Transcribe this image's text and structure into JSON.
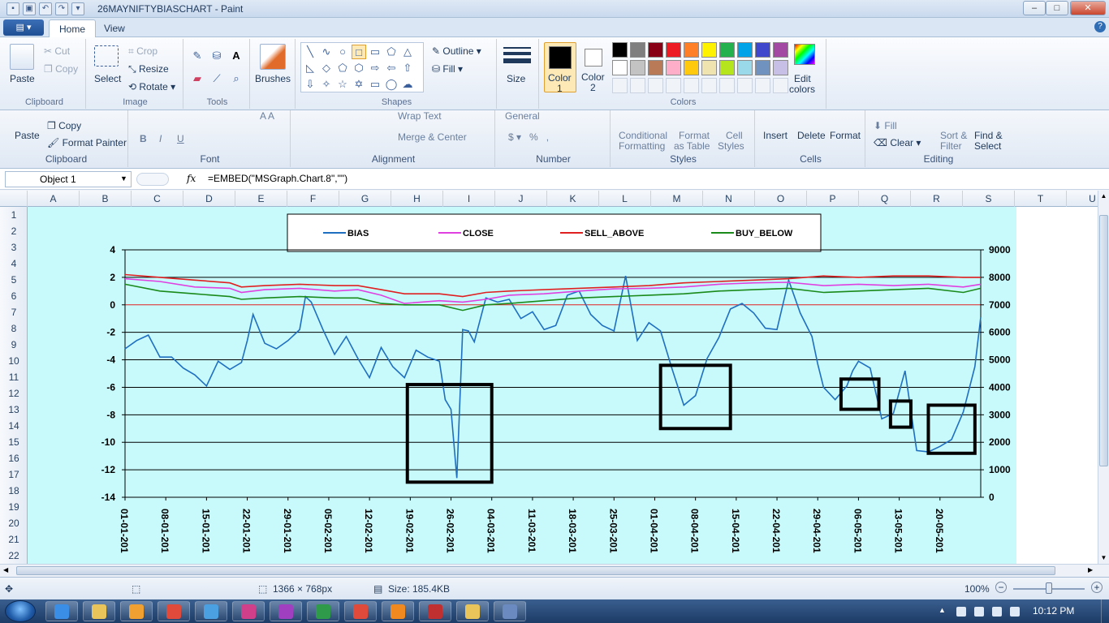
{
  "window": {
    "title": "26MAYNIFTYBIASCHART - Paint",
    "minimize": "–",
    "maximize": "□",
    "close": "✕"
  },
  "paint_tabs": {
    "file_menu": "▤ ▾",
    "home": "Home",
    "view": "View"
  },
  "paint_ribbon": {
    "clipboard": {
      "paste": "Paste",
      "cut": "Cut",
      "copy": "Copy",
      "label": "Clipboard"
    },
    "image": {
      "select": "Select",
      "crop": "Crop",
      "resize": "Resize",
      "rotate": "Rotate",
      "label": "Image"
    },
    "tools": {
      "label": "Tools"
    },
    "brushes": {
      "label": "Brushes"
    },
    "shapes": {
      "outline": "Outline",
      "fill": "Fill",
      "label": "Shapes"
    },
    "size": {
      "label": "Size"
    },
    "colors": {
      "color1": "Color\n1",
      "color1_a": "Color",
      "color1_b": "1",
      "color2_a": "Color",
      "color2_b": "2",
      "edit_a": "Edit",
      "edit_b": "colors",
      "label": "Colors",
      "palette_row1": [
        "#000000",
        "#7f7f7f",
        "#880015",
        "#ed1c24",
        "#ff7f27",
        "#fff200",
        "#22b14c",
        "#00a2e8",
        "#3f48cc",
        "#a349a4"
      ],
      "palette_row2": [
        "#ffffff",
        "#c3c3c3",
        "#b97a57",
        "#ffaec9",
        "#ffc90e",
        "#efe4b0",
        "#b5e61d",
        "#99d9ea",
        "#7092be",
        "#c8bfe7"
      ]
    }
  },
  "excel_ribbon": {
    "clipboard": {
      "paste": "Paste",
      "copy": "Copy",
      "format_painter": "Format Painter",
      "label": "Clipboard"
    },
    "font": {
      "label": "Font"
    },
    "alignment": {
      "wrap_text": "Wrap Text",
      "merge_center": "Merge & Center",
      "label": "Alignment"
    },
    "number": {
      "format": "General",
      "label": "Number"
    },
    "styles": {
      "conditional_a": "Conditional",
      "conditional_b": "Formatting",
      "format_table_a": "Format",
      "format_table_b": "as Table",
      "cell_styles_a": "Cell",
      "cell_styles_b": "Styles",
      "label": "Styles"
    },
    "cells": {
      "insert": "Insert",
      "delete": "Delete",
      "format": "Format",
      "label": "Cells"
    },
    "editing": {
      "fill": "Fill",
      "clear": "Clear",
      "sort_a": "Sort &",
      "sort_b": "Filter",
      "find_a": "Find &",
      "find_b": "Select",
      "label": "Editing"
    }
  },
  "formula_bar": {
    "name_box": "Object 1",
    "fx": "fx",
    "formula": "=EMBED(\"MSGraph.Chart.8\",\"\")"
  },
  "columns": [
    "A",
    "B",
    "C",
    "D",
    "E",
    "F",
    "G",
    "H",
    "I",
    "J",
    "K",
    "L",
    "M",
    "N",
    "O",
    "P",
    "Q",
    "R",
    "S",
    "T",
    "U"
  ],
  "rows": [
    "1",
    "2",
    "3",
    "4",
    "5",
    "6",
    "7",
    "8",
    "9",
    "10",
    "11",
    "12",
    "13",
    "14",
    "15",
    "16",
    "17",
    "18",
    "19",
    "20",
    "21",
    "22"
  ],
  "chart_data": {
    "type": "line",
    "title": "",
    "legend": {
      "placement": "top",
      "entries": [
        "BIAS",
        "CLOSE",
        "SELL_ABOVE",
        "BUY_BELOW"
      ]
    },
    "y_left": {
      "range": [
        -14,
        4
      ],
      "ticks": [
        "4",
        "2",
        "0",
        "-2",
        "-4",
        "-6",
        "-8",
        "-10",
        "-12",
        "-14"
      ]
    },
    "y_right": {
      "range": [
        0,
        9000
      ],
      "ticks": [
        "9000",
        "8000",
        "7000",
        "6000",
        "5000",
        "4000",
        "3000",
        "2000",
        "1000",
        "0"
      ]
    },
    "x_tick_labels": [
      "01-01-201",
      "08-01-201",
      "15-01-201",
      "22-01-201",
      "29-01-201",
      "05-02-201",
      "12-02-201",
      "19-02-201",
      "26-02-201",
      "04-03-201",
      "11-03-201",
      "18-03-201",
      "25-03-201",
      "01-04-201",
      "08-04-201",
      "15-04-201",
      "22-04-201",
      "29-04-201",
      "06-05-201",
      "13-05-201",
      "20-05-201"
    ],
    "x_range_days": [
      0,
      147
    ],
    "grid": true,
    "series": [
      {
        "name": "BIAS",
        "axis": "left",
        "color": "#1f6fc1",
        "x": [
          0,
          2,
          4,
          6,
          8,
          10,
          12,
          14,
          16,
          18,
          20,
          21,
          22,
          24,
          26,
          28,
          30,
          31,
          32,
          34,
          36,
          38,
          40,
          42,
          44,
          46,
          48,
          50,
          52,
          54,
          55,
          56,
          57,
          58,
          59,
          60,
          62,
          64,
          66,
          68,
          70,
          72,
          74,
          76,
          78,
          80,
          82,
          84,
          86,
          88,
          90,
          91,
          92,
          94,
          96,
          98,
          100,
          102,
          104,
          106,
          108,
          110,
          112,
          114,
          116,
          118,
          119,
          120,
          122,
          124,
          125,
          126,
          128,
          130,
          132,
          134,
          136,
          138,
          140,
          142,
          144,
          146,
          147
        ],
        "y": [
          -3.2,
          -2.6,
          -2.2,
          -3.8,
          -3.8,
          -4.6,
          -5.1,
          -5.9,
          -4.1,
          -4.7,
          -4.2,
          -2.6,
          -0.7,
          -2.8,
          -3.2,
          -2.6,
          -1.8,
          0.6,
          0.2,
          -1.8,
          -3.6,
          -2.3,
          -3.9,
          -5.3,
          -3.1,
          -4.5,
          -5.3,
          -3.3,
          -3.8,
          -4.1,
          -6.9,
          -7.6,
          -12.6,
          -1.8,
          -1.9,
          -2.7,
          0.5,
          0.2,
          0.4,
          -1.0,
          -0.5,
          -1.8,
          -1.5,
          0.7,
          1.0,
          -0.7,
          -1.5,
          -1.9,
          2.1,
          -2.6,
          -1.3,
          -1.6,
          -1.9,
          -4.7,
          -7.3,
          -6.6,
          -3.9,
          -2.4,
          -0.3,
          0.1,
          -0.6,
          -1.7,
          -1.8,
          1.8,
          -0.6,
          -2.3,
          -4.3,
          -6.0,
          -6.9,
          -5.9,
          -4.8,
          -4.1,
          -4.6,
          -8.3,
          -7.9,
          -4.8,
          -10.6,
          -10.7,
          -10.3,
          -9.8,
          -7.8,
          -4.5,
          -0.9
        ]
      },
      {
        "name": "CLOSE",
        "axis": "right",
        "color": "#e040e0",
        "x": [
          0,
          6,
          12,
          18,
          20,
          24,
          30,
          36,
          40,
          44,
          48,
          54,
          58,
          62,
          66,
          72,
          78,
          84,
          90,
          96,
          102,
          108,
          114,
          120,
          126,
          132,
          138,
          144,
          147
        ],
        "y": [
          7950,
          7850,
          7650,
          7600,
          7450,
          7550,
          7600,
          7500,
          7550,
          7350,
          7050,
          7150,
          7100,
          7200,
          7350,
          7400,
          7500,
          7580,
          7600,
          7650,
          7750,
          7800,
          7820,
          7700,
          7750,
          7700,
          7750,
          7650,
          7750
        ]
      },
      {
        "name": "SELL_ABOVE",
        "axis": "right",
        "color": "#e02020",
        "x": [
          0,
          6,
          12,
          18,
          20,
          24,
          30,
          36,
          40,
          44,
          48,
          54,
          58,
          62,
          66,
          72,
          78,
          84,
          90,
          96,
          102,
          108,
          114,
          120,
          126,
          132,
          138,
          144,
          147
        ],
        "y": [
          8100,
          8000,
          7900,
          7800,
          7650,
          7700,
          7750,
          7700,
          7700,
          7550,
          7400,
          7400,
          7300,
          7450,
          7500,
          7550,
          7600,
          7650,
          7700,
          7800,
          7850,
          7900,
          7950,
          8050,
          8000,
          8050,
          8050,
          8000,
          8000
        ]
      },
      {
        "name": "BUY_BELOW",
        "axis": "right",
        "color": "#1a8a1a",
        "x": [
          0,
          6,
          12,
          18,
          20,
          24,
          30,
          36,
          40,
          44,
          48,
          54,
          58,
          62,
          66,
          72,
          78,
          84,
          90,
          96,
          102,
          108,
          114,
          120,
          126,
          132,
          138,
          144,
          147
        ],
        "y": [
          7750,
          7500,
          7400,
          7300,
          7200,
          7250,
          7300,
          7250,
          7250,
          7050,
          7000,
          7000,
          6800,
          7000,
          7050,
          7150,
          7250,
          7300,
          7350,
          7400,
          7500,
          7550,
          7600,
          7450,
          7500,
          7550,
          7600,
          7450,
          7600
        ]
      }
    ],
    "highlight_boxes_days": [
      {
        "x0": 48.5,
        "x1": 63,
        "y0": -5.8,
        "y1": -12.9
      },
      {
        "x0": 92,
        "x1": 104,
        "y0": -4.4,
        "y1": -9.0
      },
      {
        "x0": 123,
        "x1": 129.5,
        "y0": -5.4,
        "y1": -7.6
      },
      {
        "x0": 131.5,
        "x1": 135,
        "y0": -7.0,
        "y1": -8.9
      },
      {
        "x0": 138,
        "x1": 146,
        "y0": -7.3,
        "y1": -10.8
      }
    ]
  },
  "status_bar": {
    "dimensions": "1366 × 768px",
    "size": "Size: 185.4KB",
    "zoom": "100%"
  },
  "taskbar": {
    "clock": "10:12 PM",
    "apps": [
      "ie-icon",
      "explorer-icon",
      "media-player-icon",
      "chrome-icon",
      "app-icon",
      "app-icon",
      "app-icon",
      "excel-icon",
      "chrome-icon",
      "vlc-icon",
      "paint-icon",
      "explorer-icon",
      "app-icon"
    ]
  }
}
